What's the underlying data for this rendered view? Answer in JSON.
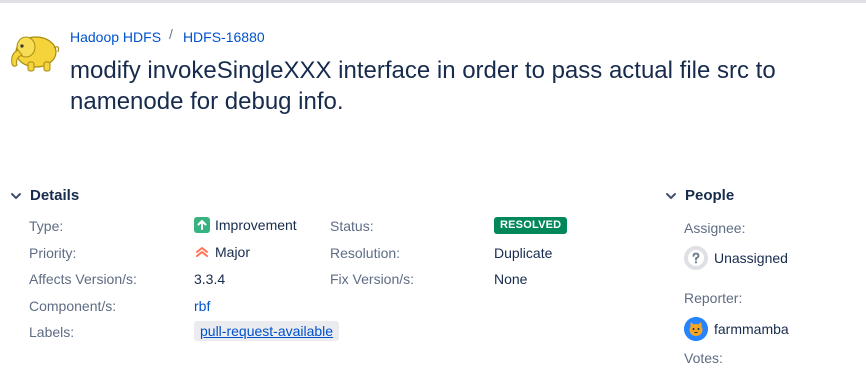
{
  "breadcrumb": {
    "project": "Hadoop HDFS",
    "separator": "/",
    "issue_key": "HDFS-16880"
  },
  "issue": {
    "title": "modify invokeSingleXXX interface in order to pass actual file src to namenode for debug info."
  },
  "details": {
    "heading": "Details",
    "type_label": "Type:",
    "type_value": "Improvement",
    "status_label": "Status:",
    "status_value": "RESOLVED",
    "priority_label": "Priority:",
    "priority_value": "Major",
    "resolution_label": "Resolution:",
    "resolution_value": "Duplicate",
    "affects_label": "Affects Version/s:",
    "affects_value": "3.3.4",
    "fix_label": "Fix Version/s:",
    "fix_value": "None",
    "component_label": "Component/s:",
    "component_value": "rbf",
    "labels_label": "Labels:",
    "labels_value": "pull-request-available"
  },
  "people": {
    "heading": "People",
    "assignee_label": "Assignee:",
    "assignee_value": "Unassigned",
    "reporter_label": "Reporter:",
    "reporter_value": "farmmamba",
    "votes_label": "Votes:"
  },
  "icons": {
    "logo": "hadoop-elephant-icon",
    "type": "improvement-arrow-icon",
    "priority": "major-priority-icon",
    "collapse": "chevron-down-icon",
    "unassigned": "question-avatar-icon",
    "reporter": "cat-avatar-icon"
  },
  "colors": {
    "link": "#0052cc",
    "status_resolved": "#00875a",
    "improvement": "#36b37e",
    "priority_major": "#ff7452"
  }
}
